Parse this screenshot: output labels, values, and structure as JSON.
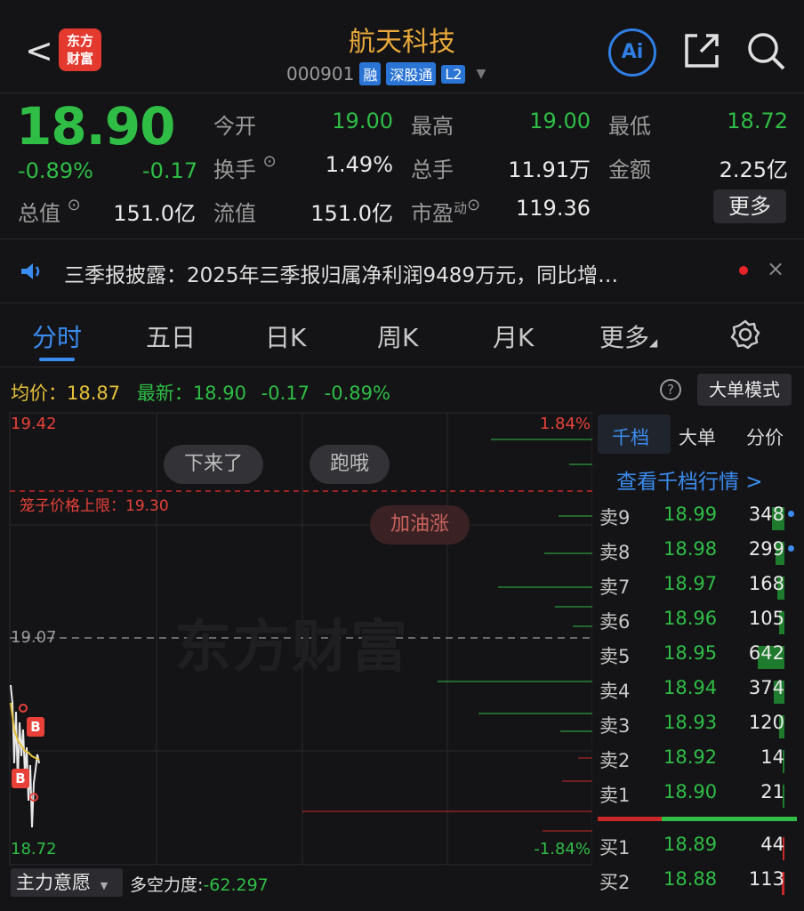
{
  "header": {
    "back_glyph": "<",
    "logo_line1": "东方",
    "logo_line2": "财富",
    "title": "航天科技",
    "code": "000901",
    "tags": [
      "融",
      "深股通",
      "L2"
    ],
    "ai_label": "Ai"
  },
  "quote": {
    "price": "18.90",
    "pct": "-0.89%",
    "change": "-0.17",
    "fields": {
      "open_label": "今开",
      "open": "19.00",
      "high_label": "最高",
      "high": "19.00",
      "low_label": "最低",
      "low": "18.72",
      "turnover_label": "换手",
      "turnover": "1.49%",
      "volume_label": "总手",
      "volume": "11.91万",
      "amount_label": "金额",
      "amount": "2.25亿",
      "mktcap_label": "总值",
      "mktcap": "151.0亿",
      "float_label": "流值",
      "float": "151.0亿",
      "pe_label": "市盈",
      "pe_sup": "动",
      "pe": "119.36"
    },
    "more_label": "更多"
  },
  "news": {
    "text": "三季报披露：2025年三季报归属净利润9489万元，同比增…",
    "close": "×"
  },
  "tabs": [
    "分时",
    "五日",
    "日K",
    "周K",
    "月K",
    "更多"
  ],
  "chart": {
    "avg_label": "均价：",
    "avg_value": "18.87",
    "latest_label": "最新：",
    "latest_price": "18.90",
    "latest_change": "-0.17",
    "latest_pct": "-0.89%",
    "help": "?",
    "big_order_mode": "大单模式",
    "y_high": "19.42",
    "y_mid": "19.07",
    "y_low": "18.72",
    "pct_high": "1.84%",
    "pct_low": "-1.84%",
    "cage_label": "笼子价格上限：19.30",
    "bubbles": [
      "下来了",
      "跑哦",
      "加油涨"
    ],
    "watermark": "东方财富",
    "markers": [
      "B",
      "B"
    ],
    "zhuli_label": "主力意愿",
    "duokong_label": "多空力度:",
    "duokong_value": "-62.297"
  },
  "orderbook": {
    "tabs": [
      "千档",
      "大单",
      "分价"
    ],
    "link": "查看千档行情 >",
    "asks": [
      {
        "label": "卖9",
        "price": "18.99",
        "vol": "348"
      },
      {
        "label": "卖8",
        "price": "18.98",
        "vol": "299"
      },
      {
        "label": "卖7",
        "price": "18.97",
        "vol": "168"
      },
      {
        "label": "卖6",
        "price": "18.96",
        "vol": "105"
      },
      {
        "label": "卖5",
        "price": "18.95",
        "vol": "642"
      },
      {
        "label": "卖4",
        "price": "18.94",
        "vol": "374"
      },
      {
        "label": "卖3",
        "price": "18.93",
        "vol": "120"
      },
      {
        "label": "卖2",
        "price": "18.92",
        "vol": "14"
      },
      {
        "label": "卖1",
        "price": "18.90",
        "vol": "21"
      }
    ],
    "bids": [
      {
        "label": "买1",
        "price": "18.89",
        "vol": "44"
      },
      {
        "label": "买2",
        "price": "18.88",
        "vol": "113"
      }
    ]
  }
}
